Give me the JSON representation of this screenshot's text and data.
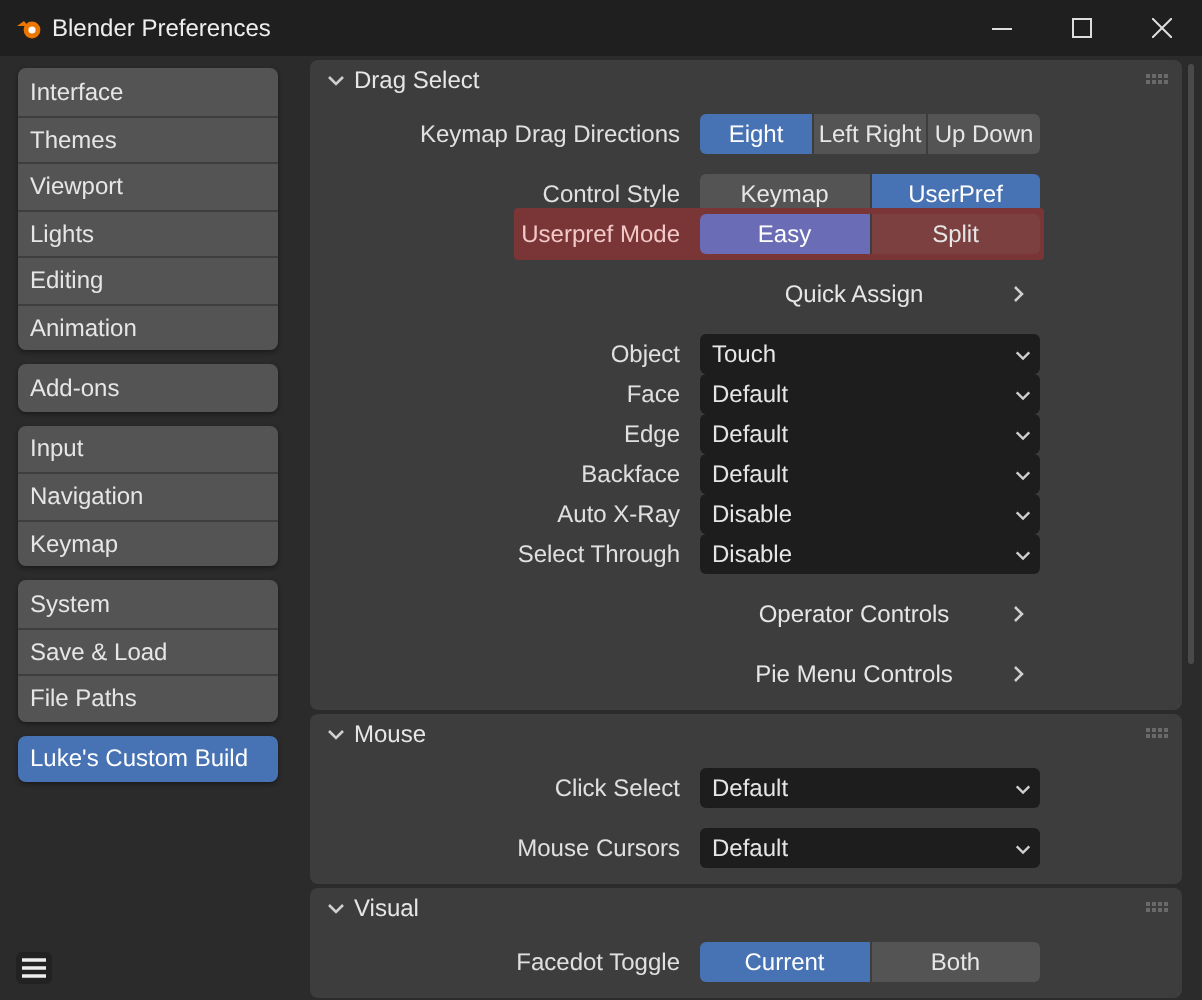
{
  "window": {
    "title": "Blender Preferences"
  },
  "sidebar": {
    "groups": [
      [
        {
          "label": "Interface",
          "selected": false
        },
        {
          "label": "Themes",
          "selected": false
        },
        {
          "label": "Viewport",
          "selected": false
        },
        {
          "label": "Lights",
          "selected": false
        },
        {
          "label": "Editing",
          "selected": false
        },
        {
          "label": "Animation",
          "selected": false
        }
      ],
      [
        {
          "label": "Add-ons",
          "selected": false
        }
      ],
      [
        {
          "label": "Input",
          "selected": false
        },
        {
          "label": "Navigation",
          "selected": false
        },
        {
          "label": "Keymap",
          "selected": false
        }
      ],
      [
        {
          "label": "System",
          "selected": false
        },
        {
          "label": "Save & Load",
          "selected": false
        },
        {
          "label": "File Paths",
          "selected": false
        }
      ],
      [
        {
          "label": "Luke's Custom Build",
          "selected": true
        }
      ]
    ]
  },
  "panels": [
    {
      "title": "Drag Select",
      "expanded": true,
      "groups": [
        [
          {
            "kind": "enum",
            "label": "Keymap Drag Directions",
            "highlighted": false,
            "options": [
              {
                "label": "Eight",
                "selected": true
              },
              {
                "label": "Left Right",
                "selected": false
              },
              {
                "label": "Up Down",
                "selected": false
              }
            ]
          }
        ],
        [
          {
            "kind": "enum",
            "label": "Control Style",
            "highlighted": false,
            "options": [
              {
                "label": "Keymap",
                "selected": false
              },
              {
                "label": "UserPref",
                "selected": true
              }
            ]
          },
          {
            "kind": "enum",
            "label": "Userpref Mode",
            "highlighted": true,
            "options": [
              {
                "label": "Easy",
                "selected": true
              },
              {
                "label": "Split",
                "selected": false
              }
            ]
          }
        ],
        [
          {
            "kind": "submenu",
            "label": "Quick Assign"
          }
        ],
        [
          {
            "kind": "dropdown",
            "label": "Object",
            "value": "Touch"
          },
          {
            "kind": "dropdown",
            "label": "Face",
            "value": "Default"
          },
          {
            "kind": "dropdown",
            "label": "Edge",
            "value": "Default"
          },
          {
            "kind": "dropdown",
            "label": "Backface",
            "value": "Default"
          },
          {
            "kind": "dropdown",
            "label": "Auto X-Ray",
            "value": "Disable"
          },
          {
            "kind": "dropdown",
            "label": "Select Through",
            "value": "Disable"
          }
        ],
        [
          {
            "kind": "submenu",
            "label": "Operator Controls"
          }
        ],
        [
          {
            "kind": "submenu",
            "label": "Pie Menu Controls"
          }
        ]
      ]
    },
    {
      "title": "Mouse",
      "expanded": true,
      "groups": [
        [
          {
            "kind": "dropdown",
            "label": "Click Select",
            "value": "Default"
          }
        ],
        [
          {
            "kind": "dropdown",
            "label": "Mouse Cursors",
            "value": "Default"
          }
        ]
      ]
    },
    {
      "title": "Visual",
      "expanded": true,
      "groups": [
        [
          {
            "kind": "enum",
            "label": "Facedot Toggle",
            "highlighted": false,
            "options": [
              {
                "label": "Current",
                "selected": true
              },
              {
                "label": "Both",
                "selected": false
              }
            ]
          }
        ]
      ]
    }
  ]
}
